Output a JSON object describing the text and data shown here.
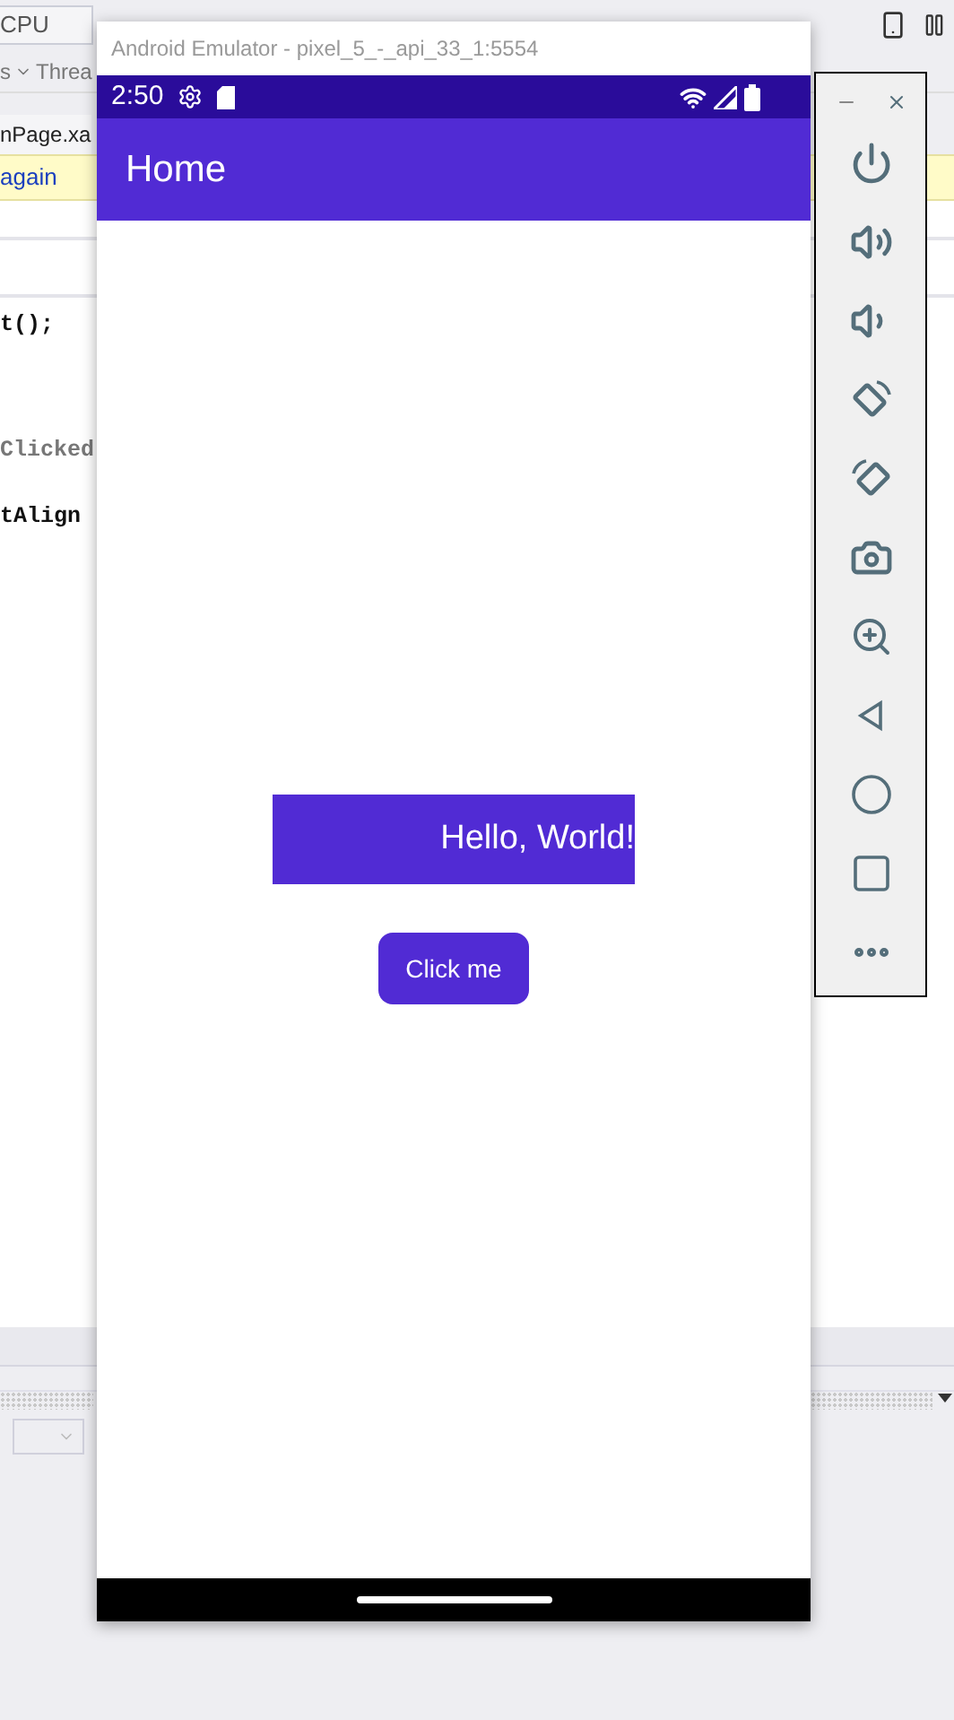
{
  "ide": {
    "config_field": "CPU",
    "thread_prefix": "s",
    "thread_label": "Threa",
    "doc_tab": "nPage.xa",
    "info_bar": "again",
    "code_lines": [
      {
        "text": "t();",
        "dimmed": false
      },
      {
        "text": "Clicked",
        "dimmed": true
      },
      {
        "text": "tAlign",
        "dimmed": false
      }
    ]
  },
  "emulator": {
    "title": "Android Emulator - pixel_5_-_api_33_1:5554",
    "status_bar": {
      "time": "2:50"
    },
    "app_bar": {
      "title": "Home"
    },
    "label": "Hello, World!",
    "button": "Click me"
  }
}
